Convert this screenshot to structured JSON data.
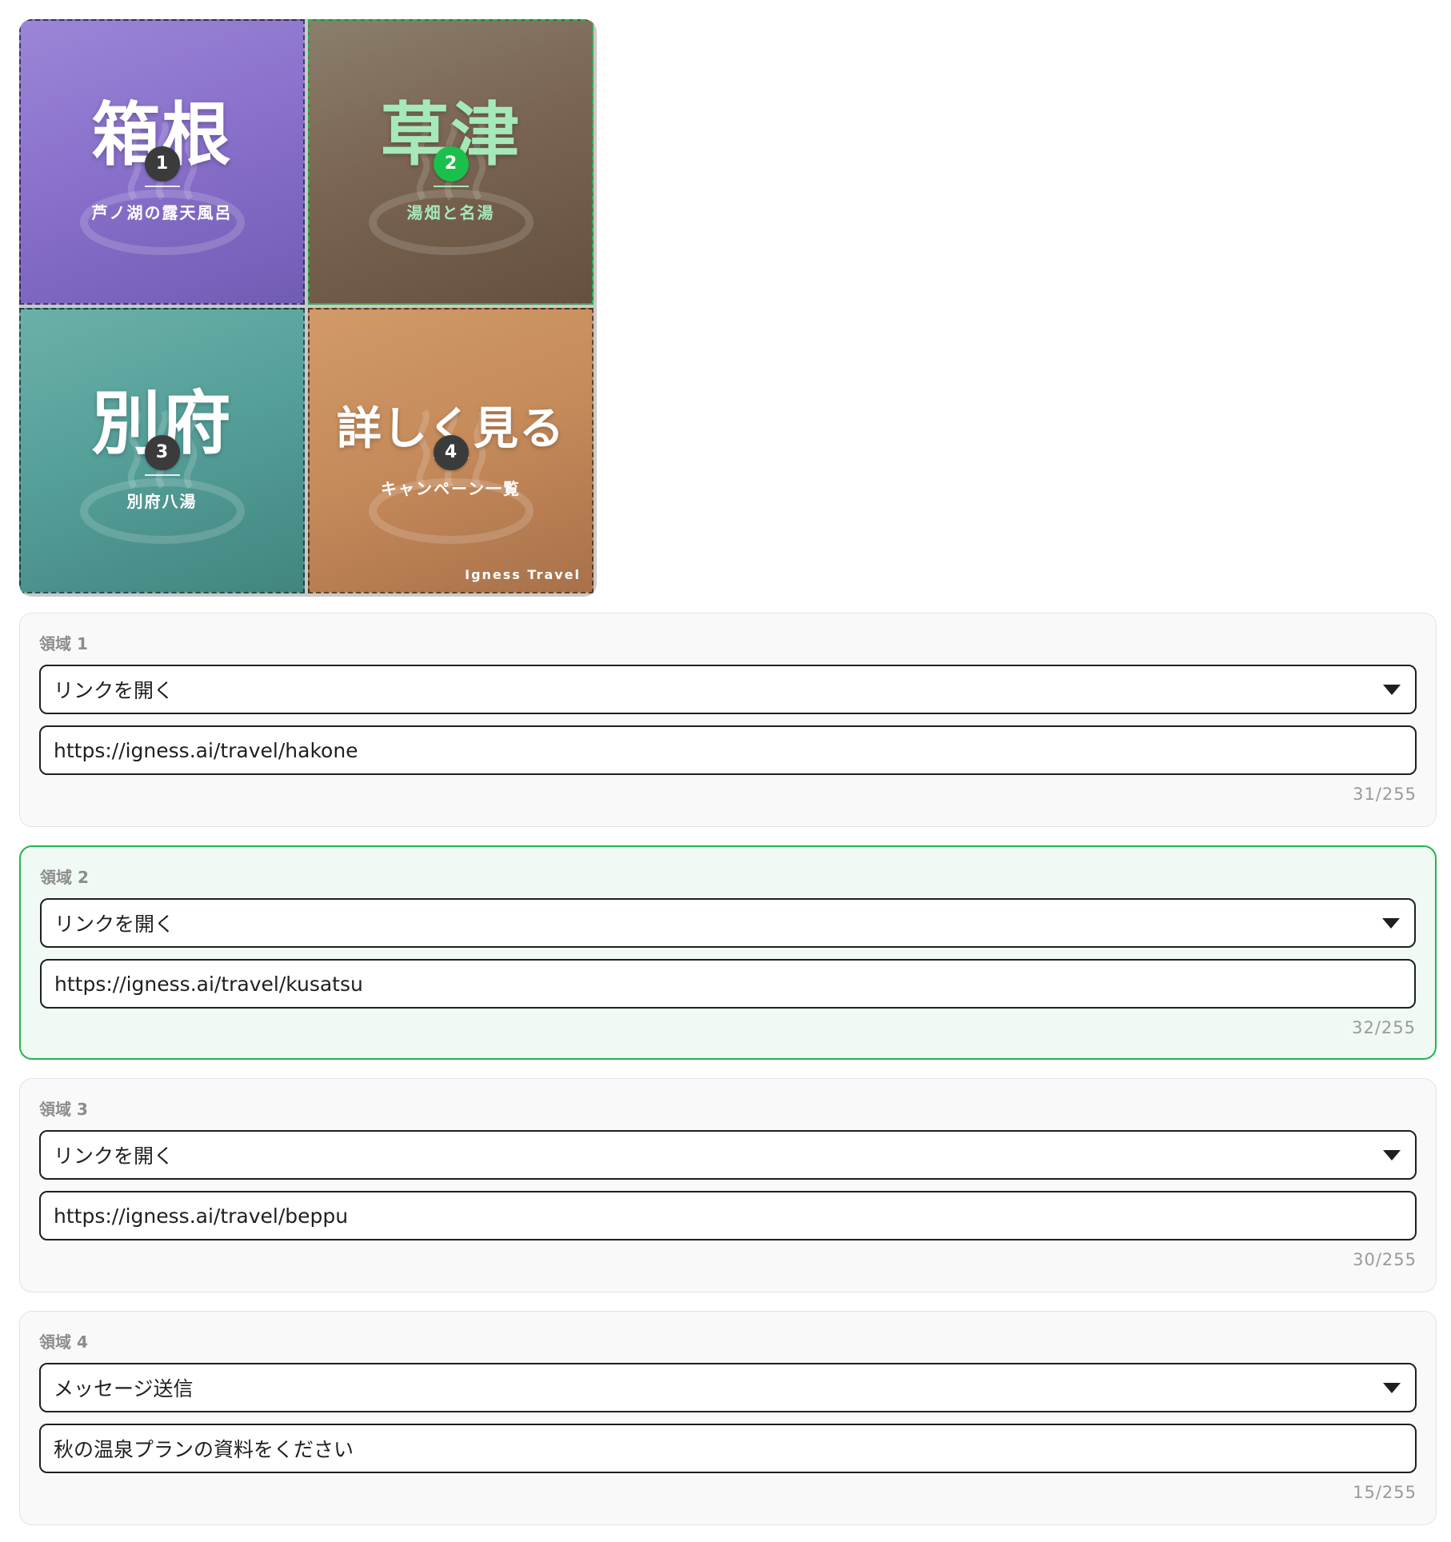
{
  "imagemap": {
    "tiles": [
      {
        "title": "箱根",
        "subtitle": "芦ノ湖の露天風呂",
        "badge": "1"
      },
      {
        "title": "草津",
        "subtitle": "湯畑と名湯",
        "badge": "2"
      },
      {
        "title": "別府",
        "subtitle": "別府八湯",
        "badge": "3"
      },
      {
        "title": "詳しく見る",
        "subtitle": "キャンペーン一覧",
        "badge": "4"
      }
    ],
    "brand": "Igness Travel",
    "selected_tile": "2"
  },
  "regions": [
    {
      "label": "領域 1",
      "action": "リンクを開く",
      "value": "https://igness.ai/travel/hakone",
      "counter": "31/255"
    },
    {
      "label": "領域 2",
      "action": "リンクを開く",
      "value": "https://igness.ai/travel/kusatsu",
      "counter": "32/255"
    },
    {
      "label": "領域 3",
      "action": "リンクを開く",
      "value": "https://igness.ai/travel/beppu",
      "counter": "30/255"
    },
    {
      "label": "領域 4",
      "action": "メッセージ送信",
      "value": "秋の温泉プランの資料をください",
      "counter": "15/255"
    }
  ],
  "colors": {
    "accent": "#22b54f",
    "badge_active": "#1bbf4c",
    "tile1": "#8a71cc",
    "tile2": "#7a6552",
    "tile3": "#56a09a",
    "tile4": "#c58a5a"
  }
}
